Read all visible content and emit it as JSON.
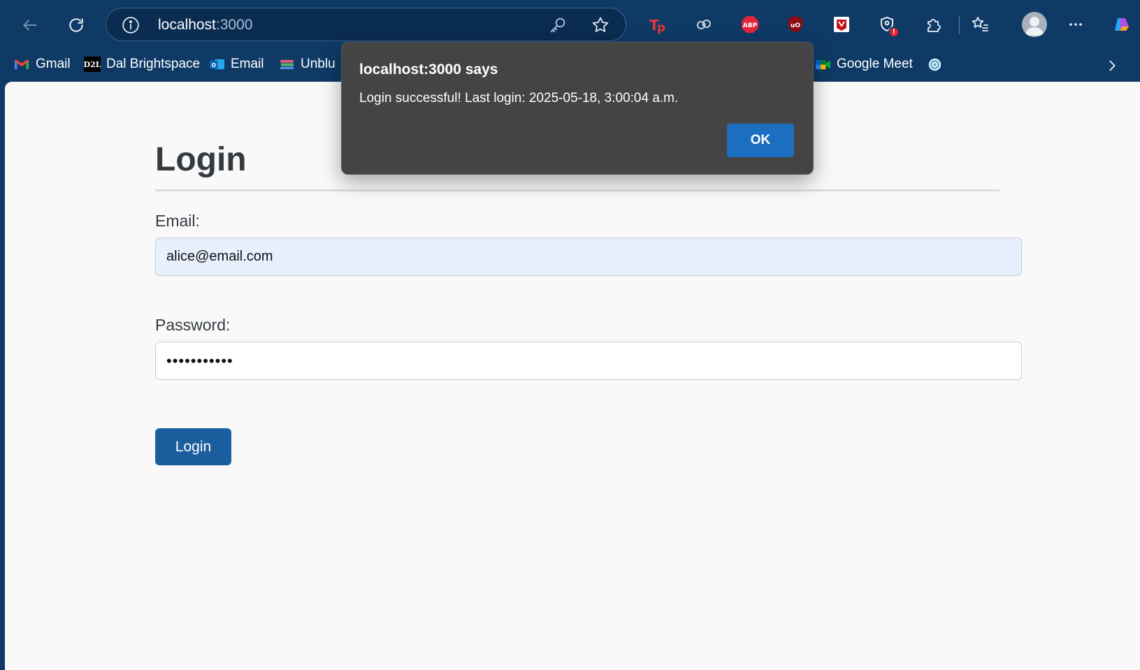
{
  "browser": {
    "address": {
      "host": "localhost",
      "port": ":3000"
    },
    "extensions": [
      "tp-icon",
      "link-icon",
      "adblock-plus-icon",
      "ublock-icon",
      "mcafee-icon",
      "tracker-icon",
      "extensions-puzzle-icon"
    ],
    "tracker_badge": "!"
  },
  "bookmarks": {
    "items": [
      {
        "label": "Gmail",
        "icon": "gmail-icon"
      },
      {
        "label": "Dal Brightspace",
        "icon": "d2l-icon"
      },
      {
        "label": "Email",
        "icon": "outlook-icon"
      },
      {
        "label": "Unblu",
        "icon": "books-icon"
      },
      {
        "label": "Google Meet",
        "icon": "google-meet-icon"
      },
      {
        "label": "",
        "icon": "globe-icon"
      }
    ]
  },
  "page": {
    "title": "Login",
    "email_label": "Email:",
    "email_value": "alice@email.com",
    "password_label": "Password:",
    "password_masked": "•••••••••••",
    "login_button": "Login"
  },
  "dialog": {
    "title": "localhost:3000 says",
    "message": "Login successful! Last login: 2025-05-18, 3:00:04 a.m.",
    "ok_label": "OK"
  },
  "colors": {
    "browser_chrome": "#0f3a66",
    "dialog_bg": "#444444",
    "primary_button": "#1b5e9e",
    "autofill_bg": "#e8f0fe"
  }
}
